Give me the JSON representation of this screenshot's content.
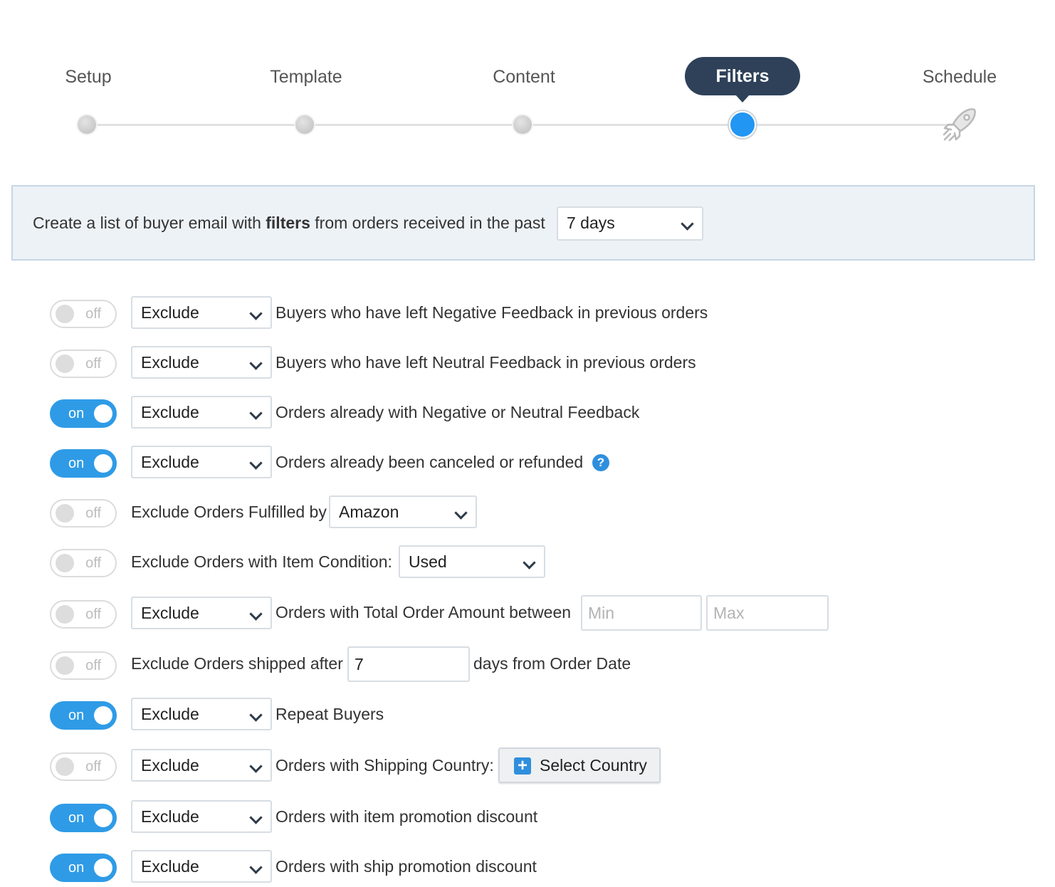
{
  "wizard": {
    "steps": [
      {
        "label": "Setup"
      },
      {
        "label": "Template"
      },
      {
        "label": "Content"
      },
      {
        "label": "Filters"
      },
      {
        "label": "Schedule"
      }
    ],
    "active_step": "Filters"
  },
  "info": {
    "text_before": "Create a list of buyer email with ",
    "text_bold": "filters",
    "text_after": " from orders received in the past",
    "period_select": "7 days"
  },
  "filters": [
    {
      "toggle": "off",
      "action": "Exclude",
      "text": "Buyers who have left Negative Feedback in previous orders"
    },
    {
      "toggle": "off",
      "action": "Exclude",
      "text": "Buyers who have left Neutral Feedback in previous orders"
    },
    {
      "toggle": "on",
      "action": "Exclude",
      "text": "Orders already with Negative or Neutral Feedback"
    },
    {
      "toggle": "on",
      "action": "Exclude",
      "text": "Orders already been canceled or refunded",
      "help": "?"
    },
    {
      "toggle": "off",
      "text": "Exclude Orders Fulfilled by",
      "select": "Amazon"
    },
    {
      "toggle": "off",
      "text": "Exclude Orders with Item Condition:",
      "select": "Used"
    },
    {
      "toggle": "off",
      "action": "Exclude",
      "text": "Orders with Total Order Amount between",
      "min_placeholder": "Min",
      "max_placeholder": "Max"
    },
    {
      "toggle": "off",
      "text": "Exclude Orders shipped after",
      "value": "7",
      "text_after": "days from Order Date"
    },
    {
      "toggle": "on",
      "action": "Exclude",
      "text": "Repeat Buyers"
    },
    {
      "toggle": "off",
      "action": "Exclude",
      "text": "Orders with Shipping Country:",
      "button": "Select Country",
      "button_icon": "+"
    },
    {
      "toggle": "on",
      "action": "Exclude",
      "text": "Orders with item promotion discount"
    },
    {
      "toggle": "on",
      "action": "Exclude",
      "text": "Orders with ship promotion discount"
    }
  ],
  "icons": {
    "chevron": "chevron-down-icon",
    "help": "question-icon",
    "plus": "plus-icon",
    "rocket": "rocket-icon"
  },
  "colors": {
    "toggle_on": "#2f9be6",
    "active_step_bg": "#2e4159",
    "active_dot": "#2196f3",
    "panel_bg": "#edf2f7"
  }
}
